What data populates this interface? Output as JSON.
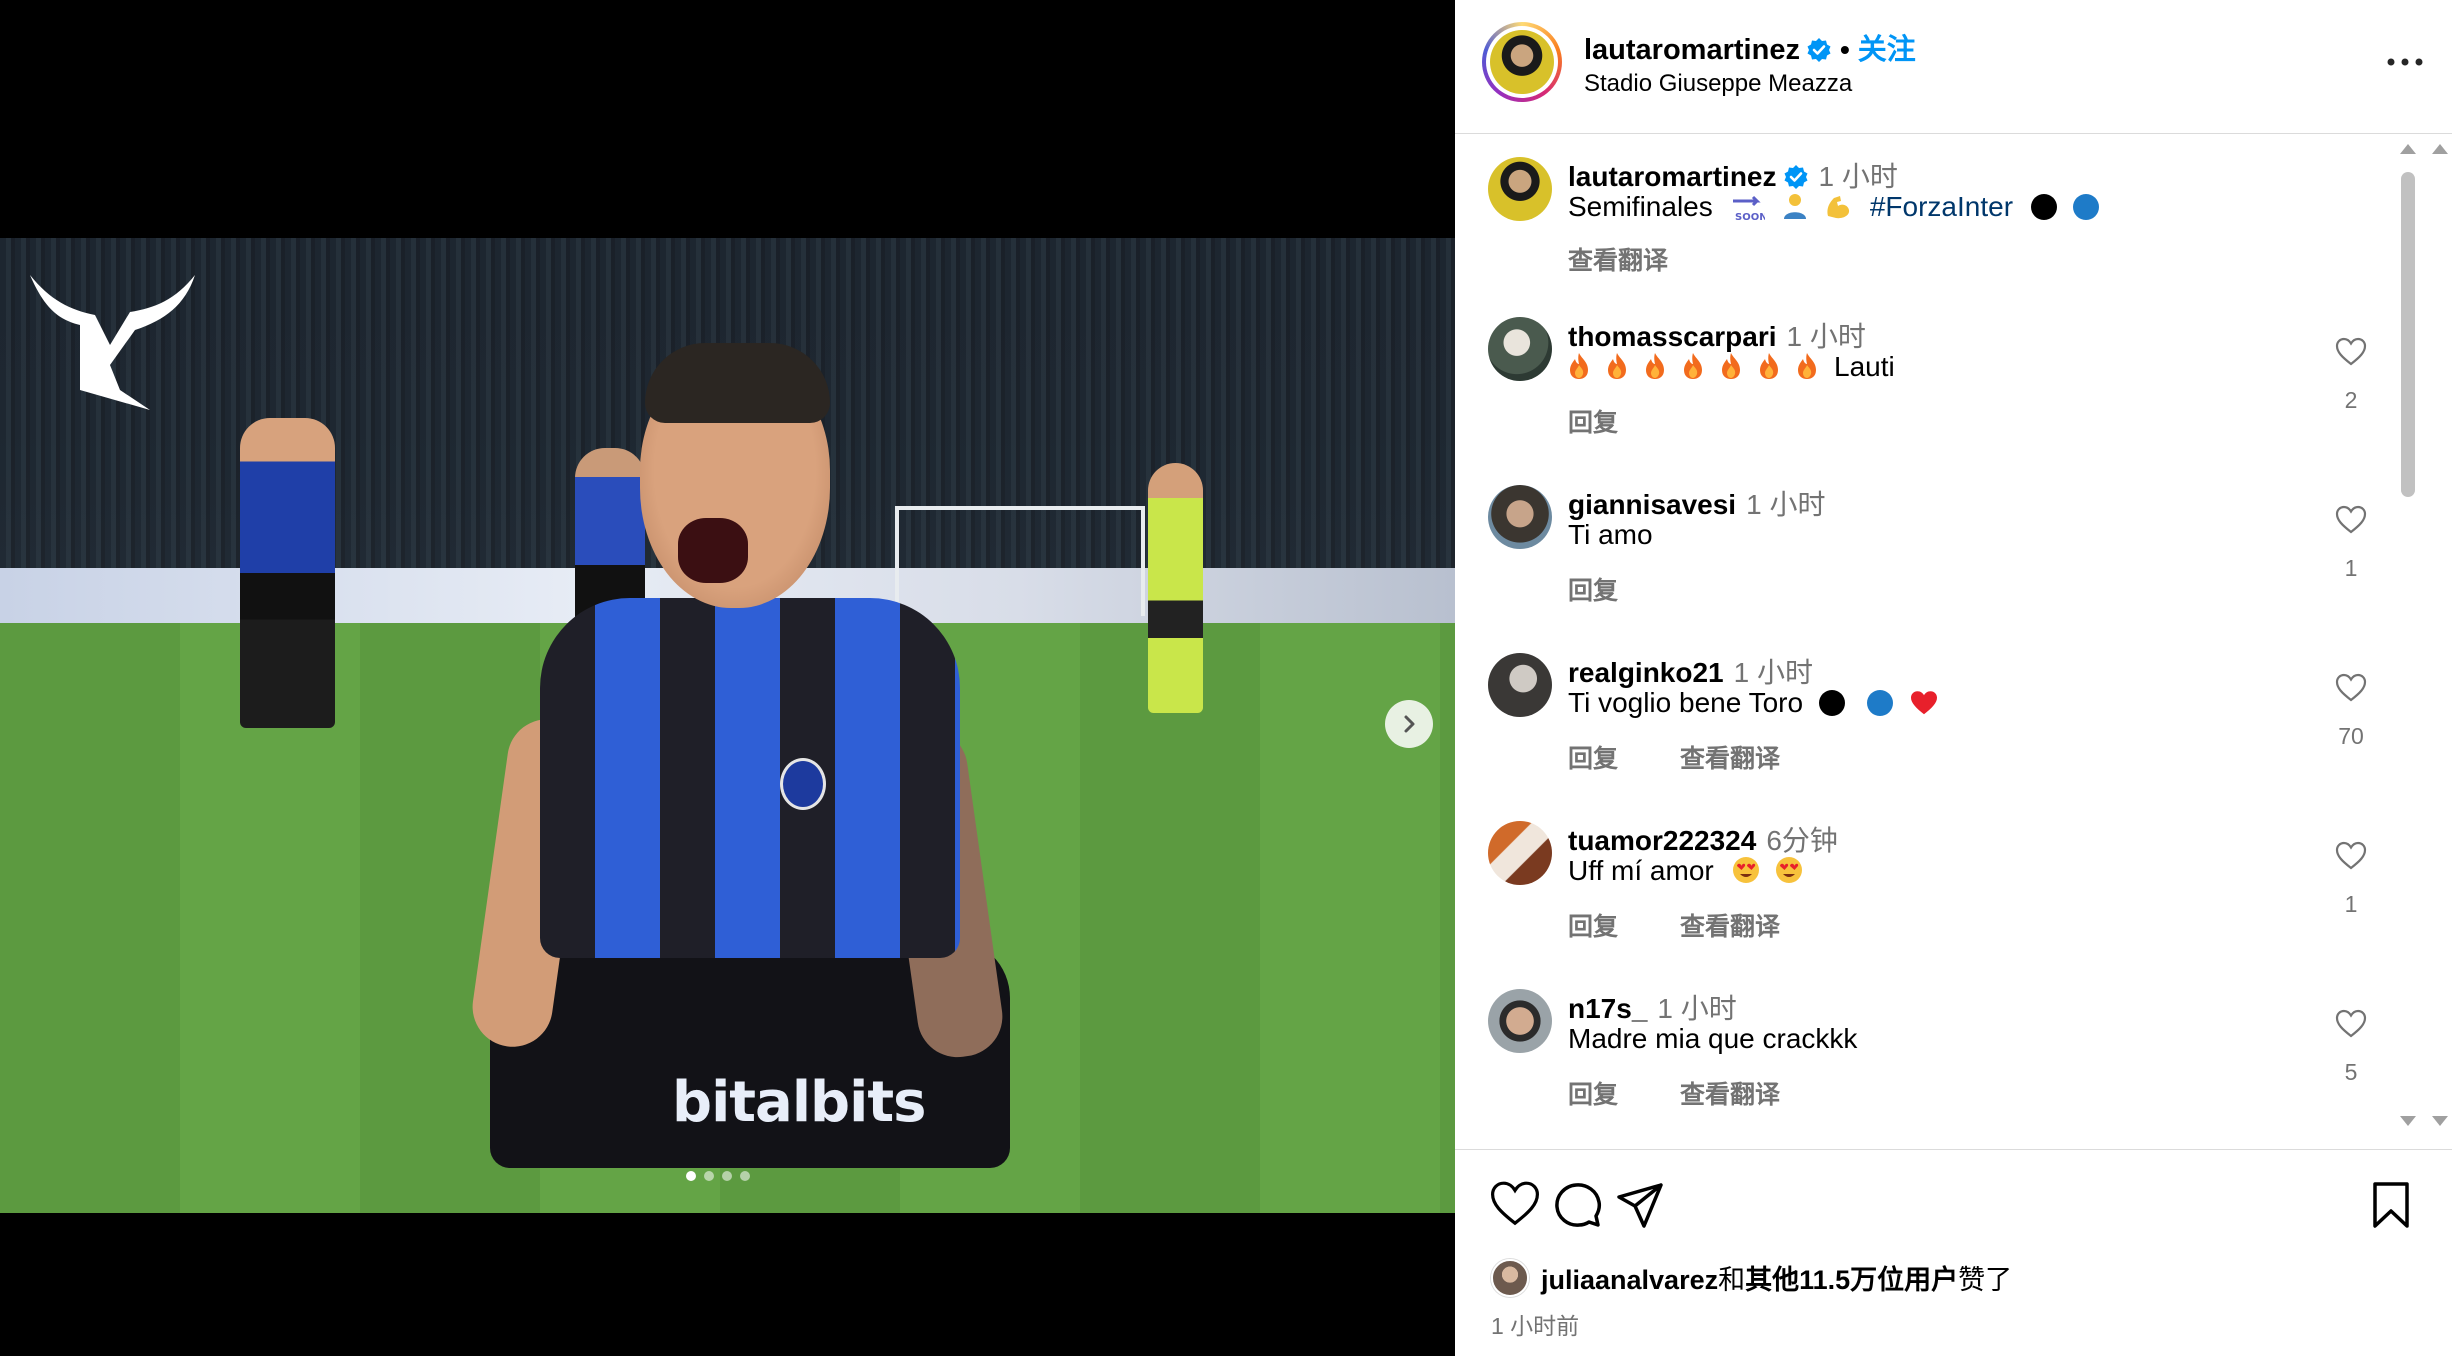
{
  "media": {
    "sponsor_text": "bitalbits",
    "logo_name": "LM bull logo",
    "carousel": {
      "total": 4,
      "active": 0
    }
  },
  "header": {
    "username": "lautaromartinez",
    "separator": "•",
    "follow_label": "关注",
    "location": "Stadio Giuseppe Meazza"
  },
  "caption": {
    "username": "lautaromartinez",
    "time": "1 小时",
    "text_start": "Semifinales",
    "hashtag": "#ForzaInter",
    "translate_label": "查看翻译"
  },
  "comments": [
    {
      "username": "thomasscarpari",
      "time": "1 小时",
      "text": "Lauti",
      "flames": 7,
      "reply": "回复",
      "translate": "",
      "likes": "2"
    },
    {
      "username": "giannisavesi",
      "time": "1 小时",
      "text": "Ti amo",
      "reply": "回复",
      "translate": "",
      "likes": "1"
    },
    {
      "username": "realginko21",
      "time": "1 小时",
      "text": "Ti voglio bene Toro",
      "reply": "回复",
      "translate": "查看翻译",
      "likes": "70"
    },
    {
      "username": "tuamor222324",
      "time": "6分钟",
      "text": "Uff mí amor",
      "reply": "回复",
      "translate": "查看翻译",
      "likes": "1"
    },
    {
      "username": "n17s_",
      "time": "1 小时",
      "text": "Madre mia que crackkk",
      "reply": "回复",
      "translate": "查看翻译",
      "likes": "5"
    }
  ],
  "footer": {
    "liked_by_user": "juliaanalvarez",
    "liked_joiner": "和",
    "liked_others": "其他11.5万位用户",
    "liked_suffix": "赞了",
    "post_time": "1 小时前"
  },
  "colors": {
    "accent_blue": "#0095f6",
    "hashtag_blue": "#00376b",
    "muted_text": "#737373",
    "divider": "#dbdbdb",
    "inter_blue": "#2f5fd6"
  },
  "icons": [
    "verified-badge-icon",
    "more-options-icon",
    "heart-icon",
    "comment-icon",
    "share-icon",
    "bookmark-icon",
    "chevron-right-icon",
    "flame-icon"
  ]
}
